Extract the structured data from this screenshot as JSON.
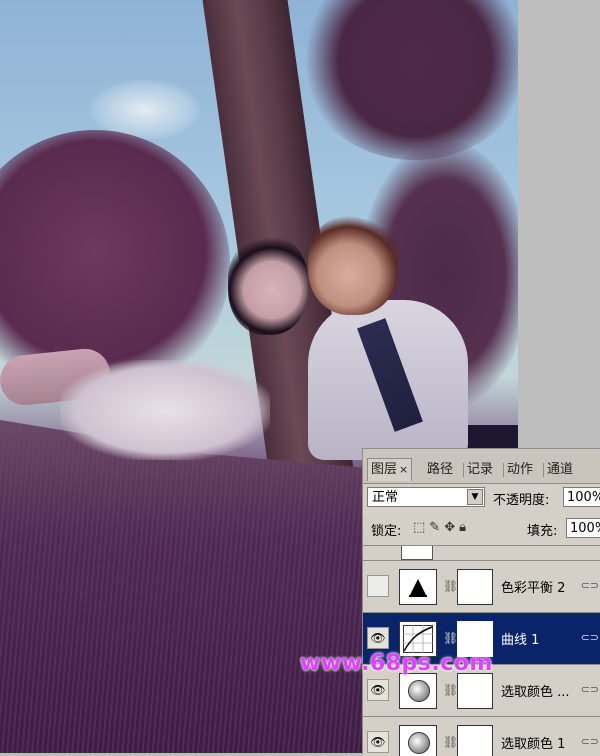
{
  "layers_panel": {
    "tabs": [
      {
        "label": "图层",
        "active": true
      },
      {
        "label": "路径",
        "active": false
      },
      {
        "label": "记录",
        "active": false
      },
      {
        "label": "动作",
        "active": false
      },
      {
        "label": "通道",
        "active": false
      }
    ],
    "tab_close": "×",
    "blend_mode": "正常",
    "opacity_label": "不透明度:",
    "opacity_value": "100%",
    "lock_label": "锁定:",
    "fill_label": "填充:",
    "fill_value": "100%",
    "layers": [
      {
        "name": "色彩平衡 2",
        "visible": false,
        "selected": false,
        "thumb_icon": "color-balance-icon"
      },
      {
        "name": "曲线 1",
        "visible": true,
        "selected": true,
        "thumb_icon": "curves-icon"
      },
      {
        "name": "选取颜色 ...",
        "visible": true,
        "selected": false,
        "thumb_icon": "selective-color-icon"
      },
      {
        "name": "选取颜色 1",
        "visible": true,
        "selected": false,
        "thumb_icon": "selective-color-icon"
      }
    ]
  },
  "watermark": "www.68ps.com",
  "colors": {
    "selected_layer": "#0a246a",
    "panel_bg": "#d4d0c8",
    "watermark": "#e040ff"
  }
}
